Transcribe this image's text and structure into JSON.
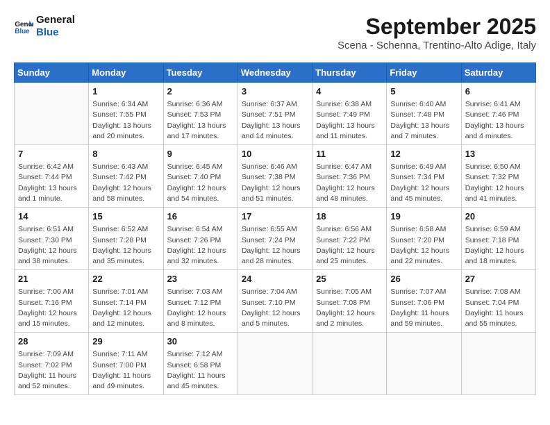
{
  "logo": {
    "text_general": "General",
    "text_blue": "Blue"
  },
  "title": "September 2025",
  "subtitle": "Scena - Schenna, Trentino-Alto Adige, Italy",
  "days_of_week": [
    "Sunday",
    "Monday",
    "Tuesday",
    "Wednesday",
    "Thursday",
    "Friday",
    "Saturday"
  ],
  "weeks": [
    [
      {
        "day": "",
        "sunrise": "",
        "sunset": "",
        "daylight": ""
      },
      {
        "day": "1",
        "sunrise": "Sunrise: 6:34 AM",
        "sunset": "Sunset: 7:55 PM",
        "daylight": "Daylight: 13 hours and 20 minutes."
      },
      {
        "day": "2",
        "sunrise": "Sunrise: 6:36 AM",
        "sunset": "Sunset: 7:53 PM",
        "daylight": "Daylight: 13 hours and 17 minutes."
      },
      {
        "day": "3",
        "sunrise": "Sunrise: 6:37 AM",
        "sunset": "Sunset: 7:51 PM",
        "daylight": "Daylight: 13 hours and 14 minutes."
      },
      {
        "day": "4",
        "sunrise": "Sunrise: 6:38 AM",
        "sunset": "Sunset: 7:49 PM",
        "daylight": "Daylight: 13 hours and 11 minutes."
      },
      {
        "day": "5",
        "sunrise": "Sunrise: 6:40 AM",
        "sunset": "Sunset: 7:48 PM",
        "daylight": "Daylight: 13 hours and 7 minutes."
      },
      {
        "day": "6",
        "sunrise": "Sunrise: 6:41 AM",
        "sunset": "Sunset: 7:46 PM",
        "daylight": "Daylight: 13 hours and 4 minutes."
      }
    ],
    [
      {
        "day": "7",
        "sunrise": "Sunrise: 6:42 AM",
        "sunset": "Sunset: 7:44 PM",
        "daylight": "Daylight: 13 hours and 1 minute."
      },
      {
        "day": "8",
        "sunrise": "Sunrise: 6:43 AM",
        "sunset": "Sunset: 7:42 PM",
        "daylight": "Daylight: 12 hours and 58 minutes."
      },
      {
        "day": "9",
        "sunrise": "Sunrise: 6:45 AM",
        "sunset": "Sunset: 7:40 PM",
        "daylight": "Daylight: 12 hours and 54 minutes."
      },
      {
        "day": "10",
        "sunrise": "Sunrise: 6:46 AM",
        "sunset": "Sunset: 7:38 PM",
        "daylight": "Daylight: 12 hours and 51 minutes."
      },
      {
        "day": "11",
        "sunrise": "Sunrise: 6:47 AM",
        "sunset": "Sunset: 7:36 PM",
        "daylight": "Daylight: 12 hours and 48 minutes."
      },
      {
        "day": "12",
        "sunrise": "Sunrise: 6:49 AM",
        "sunset": "Sunset: 7:34 PM",
        "daylight": "Daylight: 12 hours and 45 minutes."
      },
      {
        "day": "13",
        "sunrise": "Sunrise: 6:50 AM",
        "sunset": "Sunset: 7:32 PM",
        "daylight": "Daylight: 12 hours and 41 minutes."
      }
    ],
    [
      {
        "day": "14",
        "sunrise": "Sunrise: 6:51 AM",
        "sunset": "Sunset: 7:30 PM",
        "daylight": "Daylight: 12 hours and 38 minutes."
      },
      {
        "day": "15",
        "sunrise": "Sunrise: 6:52 AM",
        "sunset": "Sunset: 7:28 PM",
        "daylight": "Daylight: 12 hours and 35 minutes."
      },
      {
        "day": "16",
        "sunrise": "Sunrise: 6:54 AM",
        "sunset": "Sunset: 7:26 PM",
        "daylight": "Daylight: 12 hours and 32 minutes."
      },
      {
        "day": "17",
        "sunrise": "Sunrise: 6:55 AM",
        "sunset": "Sunset: 7:24 PM",
        "daylight": "Daylight: 12 hours and 28 minutes."
      },
      {
        "day": "18",
        "sunrise": "Sunrise: 6:56 AM",
        "sunset": "Sunset: 7:22 PM",
        "daylight": "Daylight: 12 hours and 25 minutes."
      },
      {
        "day": "19",
        "sunrise": "Sunrise: 6:58 AM",
        "sunset": "Sunset: 7:20 PM",
        "daylight": "Daylight: 12 hours and 22 minutes."
      },
      {
        "day": "20",
        "sunrise": "Sunrise: 6:59 AM",
        "sunset": "Sunset: 7:18 PM",
        "daylight": "Daylight: 12 hours and 18 minutes."
      }
    ],
    [
      {
        "day": "21",
        "sunrise": "Sunrise: 7:00 AM",
        "sunset": "Sunset: 7:16 PM",
        "daylight": "Daylight: 12 hours and 15 minutes."
      },
      {
        "day": "22",
        "sunrise": "Sunrise: 7:01 AM",
        "sunset": "Sunset: 7:14 PM",
        "daylight": "Daylight: 12 hours and 12 minutes."
      },
      {
        "day": "23",
        "sunrise": "Sunrise: 7:03 AM",
        "sunset": "Sunset: 7:12 PM",
        "daylight": "Daylight: 12 hours and 8 minutes."
      },
      {
        "day": "24",
        "sunrise": "Sunrise: 7:04 AM",
        "sunset": "Sunset: 7:10 PM",
        "daylight": "Daylight: 12 hours and 5 minutes."
      },
      {
        "day": "25",
        "sunrise": "Sunrise: 7:05 AM",
        "sunset": "Sunset: 7:08 PM",
        "daylight": "Daylight: 12 hours and 2 minutes."
      },
      {
        "day": "26",
        "sunrise": "Sunrise: 7:07 AM",
        "sunset": "Sunset: 7:06 PM",
        "daylight": "Daylight: 11 hours and 59 minutes."
      },
      {
        "day": "27",
        "sunrise": "Sunrise: 7:08 AM",
        "sunset": "Sunset: 7:04 PM",
        "daylight": "Daylight: 11 hours and 55 minutes."
      }
    ],
    [
      {
        "day": "28",
        "sunrise": "Sunrise: 7:09 AM",
        "sunset": "Sunset: 7:02 PM",
        "daylight": "Daylight: 11 hours and 52 minutes."
      },
      {
        "day": "29",
        "sunrise": "Sunrise: 7:11 AM",
        "sunset": "Sunset: 7:00 PM",
        "daylight": "Daylight: 11 hours and 49 minutes."
      },
      {
        "day": "30",
        "sunrise": "Sunrise: 7:12 AM",
        "sunset": "Sunset: 6:58 PM",
        "daylight": "Daylight: 11 hours and 45 minutes."
      },
      {
        "day": "",
        "sunrise": "",
        "sunset": "",
        "daylight": ""
      },
      {
        "day": "",
        "sunrise": "",
        "sunset": "",
        "daylight": ""
      },
      {
        "day": "",
        "sunrise": "",
        "sunset": "",
        "daylight": ""
      },
      {
        "day": "",
        "sunrise": "",
        "sunset": "",
        "daylight": ""
      }
    ]
  ]
}
